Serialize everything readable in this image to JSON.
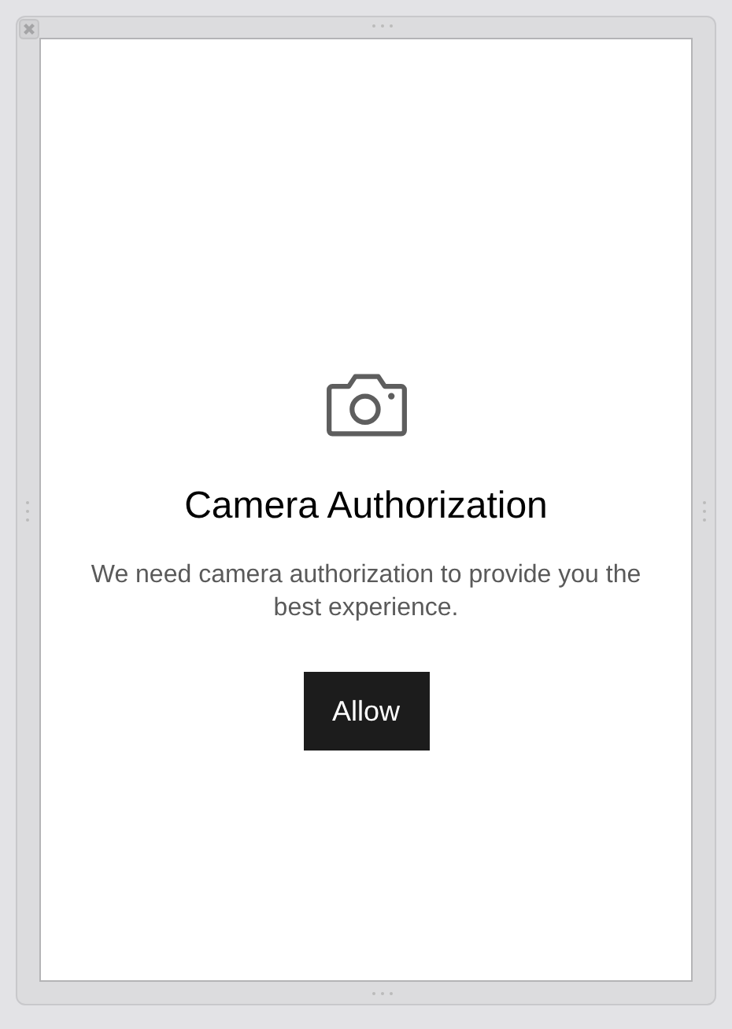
{
  "dialog": {
    "title": "Camera Authorization",
    "message": "We need camera authorization to provide you the best experience.",
    "button": "Allow"
  }
}
